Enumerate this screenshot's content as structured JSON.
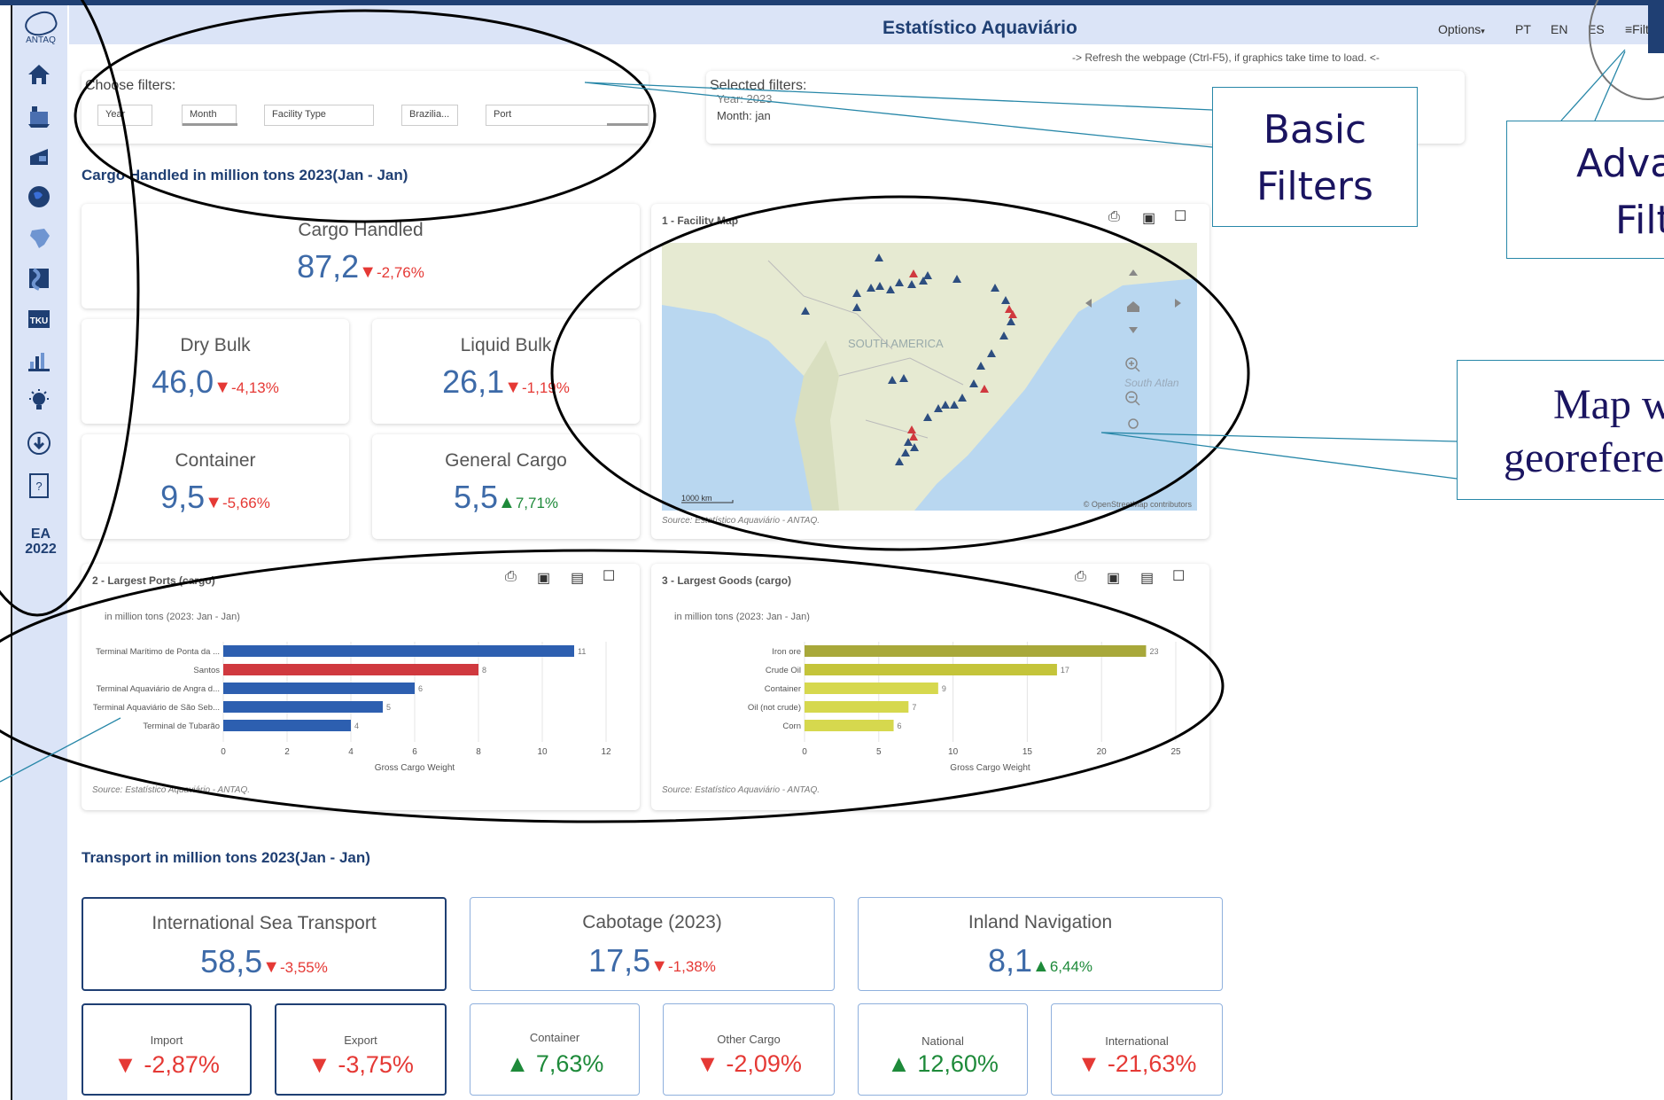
{
  "header": {
    "title": "Estatístico Aquaviário",
    "options_label": "Options",
    "langs": [
      "PT",
      "EN",
      "ES"
    ],
    "filters_label": "≡Filter"
  },
  "sidebar": {
    "logo_text": "ANTAQ",
    "ea_line1": "EA",
    "ea_line2": "2022"
  },
  "refresh_note": "-> Refresh the webpage (Ctrl-F5), if graphics take time to load. <-",
  "filters": {
    "choose_label": "Choose filters:",
    "buttons": [
      "Year",
      "Month",
      "Facility Type",
      "Brazilia...",
      "Port"
    ],
    "selected_label": "Selected filters:",
    "selected_year": "Year: 2023",
    "selected_month": "Month: jan"
  },
  "cargo_section": {
    "title": "Cargo Handled in million tons 2023(Jan - Jan)",
    "main": {
      "label": "Cargo Handled",
      "value": "87,2",
      "change": "-2,76%",
      "dir": "down"
    },
    "kpis": [
      {
        "label": "Dry Bulk",
        "value": "46,0",
        "change": "-4,13%",
        "dir": "down"
      },
      {
        "label": "Liquid Bulk",
        "value": "26,1",
        "change": "-1,19%",
        "dir": "down"
      },
      {
        "label": "Container",
        "value": "9,5",
        "change": "-5,66%",
        "dir": "down"
      },
      {
        "label": "General Cargo",
        "value": "5,5",
        "change": "7,71%",
        "dir": "up"
      }
    ]
  },
  "map_card": {
    "title": "1 - Facility Map",
    "region_label": "SOUTH AMERICA",
    "ocean_label": "South Atlan",
    "scale_label": "1000 km",
    "attribution": "© OpenStreetMap contributors",
    "source": "Source: Estatístico Aquaviário - ANTAQ."
  },
  "ports_card": {
    "title": "2 - Largest Ports (cargo)",
    "subtitle": "in million tons (2023: Jan - Jan)",
    "source": "Source: Estatístico Aquaviário - ANTAQ."
  },
  "goods_card": {
    "title": "3 - Largest Goods (cargo)",
    "subtitle": "in million tons (2023: Jan - Jan)",
    "source": "Source: Estatístico Aquaviário - ANTAQ."
  },
  "chart_data": [
    {
      "type": "bar",
      "orientation": "horizontal",
      "categories": [
        "Terminal Marítimo de Ponta da ...",
        "Santos",
        "Terminal Aquaviário de Angra d...",
        "Terminal Aquaviário de São Seb...",
        "Terminal de Tubarão"
      ],
      "values": [
        11,
        8,
        6,
        5,
        4
      ],
      "colors": [
        "#2d5fb0",
        "#d0393f",
        "#2d5fb0",
        "#2d5fb0",
        "#2d5fb0"
      ],
      "xlabel": "Gross Cargo Weight",
      "xlim": [
        0,
        12
      ],
      "xticks": [
        0,
        2,
        4,
        6,
        8,
        10,
        12
      ],
      "grid": true
    },
    {
      "type": "bar",
      "orientation": "horizontal",
      "categories": [
        "Iron ore",
        "Crude Oil",
        "Container",
        "Oil (not crude)",
        "Corn"
      ],
      "values": [
        23,
        17,
        9,
        7,
        6
      ],
      "colors": [
        "#a8a83a",
        "#c4c43a",
        "#d6d84e",
        "#d6d84e",
        "#d6d84e"
      ],
      "xlabel": "Gross Cargo Weight",
      "xlim": [
        0,
        25
      ],
      "xticks": [
        0,
        5,
        10,
        15,
        20,
        25
      ],
      "grid": true
    }
  ],
  "transport_section": {
    "title": "Transport in million tons 2023(Jan - Jan)",
    "main": [
      {
        "label": "International Sea Transport",
        "value": "58,5",
        "change": "-3,55%",
        "dir": "down"
      },
      {
        "label": "Cabotage (2023)",
        "value": "17,5",
        "change": "-1,38%",
        "dir": "down"
      },
      {
        "label": "Inland Navigation",
        "value": "8,1",
        "change": "6,44%",
        "dir": "up"
      }
    ],
    "sub": [
      {
        "label": "Import",
        "change": "-2,87%",
        "dir": "down"
      },
      {
        "label": "Export",
        "change": "-3,75%",
        "dir": "down"
      },
      {
        "label": "Container",
        "change": "7,63%",
        "dir": "up"
      },
      {
        "label": "Other Cargo",
        "change": "-2,09%",
        "dir": "down"
      },
      {
        "label": "National",
        "change": "12,60%",
        "dir": "up"
      },
      {
        "label": "International",
        "change": "-21,63%",
        "dir": "down"
      }
    ]
  },
  "annotations": {
    "basic_filters_1": "Basic",
    "basic_filters_2": "Filters",
    "advanced_1": "Adva",
    "advanced_2": "Filt",
    "map_1": "Map w",
    "map_2": "georefere"
  },
  "colors": {
    "accent": "#1f3f73",
    "down": "#e53935",
    "up": "#1e8a3a",
    "value": "#3d6aa8"
  }
}
